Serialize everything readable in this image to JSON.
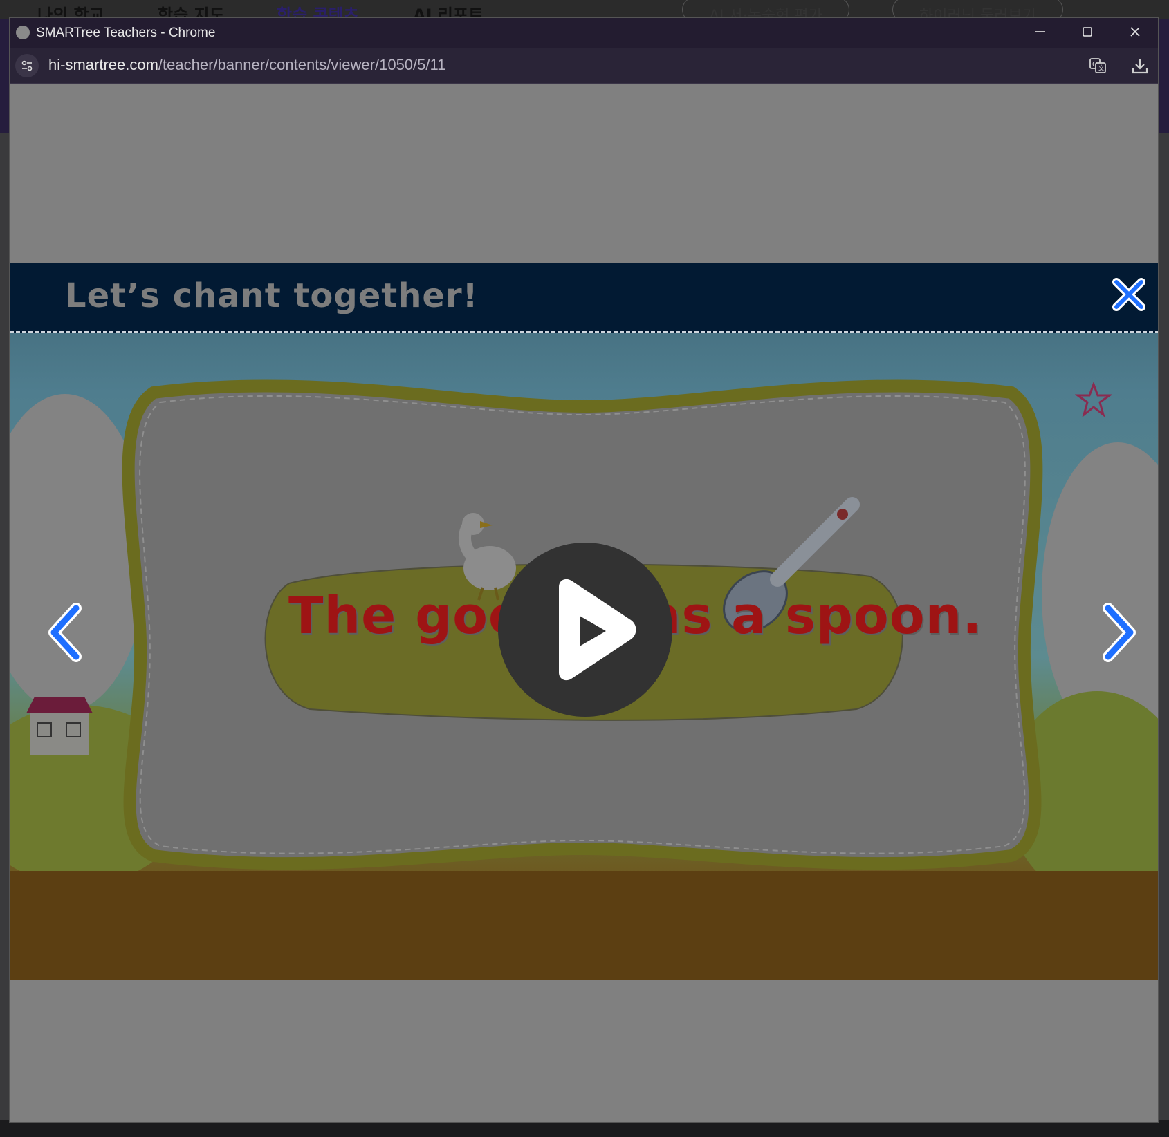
{
  "background_page": {
    "nav_items": [
      "나의 학교",
      "학습 지도",
      "학습 콘텐츠",
      "AI 리포트"
    ],
    "buttons": [
      "AI 서·논술형 평가",
      "하이러닝 둘러보기"
    ]
  },
  "window": {
    "title": "SMARTree Teachers - Chrome",
    "url_domain": "hi-smartree.com",
    "url_path": "/teacher/banner/contents/viewer/1050/5/11"
  },
  "viewer": {
    "header_title": "Let’s chant together!",
    "sentence": "The goose has a spoon.",
    "accent_color": "#1e6fff",
    "sentence_color": "#9e1414"
  }
}
